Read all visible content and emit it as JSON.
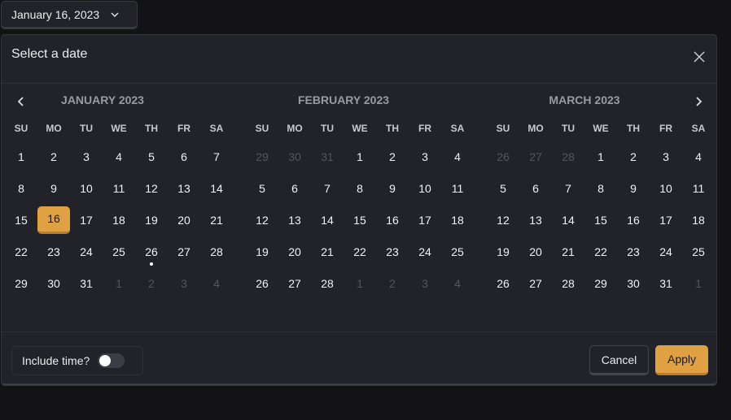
{
  "trigger": {
    "label": "January 16, 2023",
    "icon": "chevron-down-icon"
  },
  "dialog": {
    "title": "Select a date"
  },
  "weekdays": [
    "SU",
    "MO",
    "TU",
    "WE",
    "TH",
    "FR",
    "SA"
  ],
  "months": [
    {
      "title": "JANUARY 2023",
      "days": [
        "1",
        "2",
        "3",
        "4",
        "5",
        "6",
        "7",
        "8",
        "9",
        "10",
        "11",
        "12",
        "13",
        "14",
        "15",
        "16",
        "17",
        "18",
        "19",
        "20",
        "21",
        "22",
        "23",
        "24",
        "25",
        "26",
        "27",
        "28",
        "29",
        "30",
        "31",
        "1",
        "2",
        "3",
        "4"
      ],
      "outside_before": 0,
      "outside_after": 4,
      "selected_index": 15,
      "today_index": 25
    },
    {
      "title": "FEBRUARY 2023",
      "days": [
        "29",
        "30",
        "31",
        "1",
        "2",
        "3",
        "4",
        "5",
        "6",
        "7",
        "8",
        "9",
        "10",
        "11",
        "12",
        "13",
        "14",
        "15",
        "16",
        "17",
        "18",
        "19",
        "20",
        "21",
        "22",
        "23",
        "24",
        "25",
        "26",
        "27",
        "28",
        "1",
        "2",
        "3",
        "4"
      ],
      "outside_before": 3,
      "outside_after": 4,
      "selected_index": -1,
      "today_index": -1
    },
    {
      "title": "MARCH 2023",
      "days": [
        "26",
        "27",
        "28",
        "1",
        "2",
        "3",
        "4",
        "5",
        "6",
        "7",
        "8",
        "9",
        "10",
        "11",
        "12",
        "13",
        "14",
        "15",
        "16",
        "17",
        "18",
        "19",
        "20",
        "21",
        "22",
        "23",
        "24",
        "25",
        "26",
        "27",
        "28",
        "29",
        "30",
        "31",
        "1"
      ],
      "outside_before": 3,
      "outside_after": 1,
      "selected_index": -1,
      "today_index": -1
    }
  ],
  "footer": {
    "include_time_label": "Include time?",
    "include_time": false,
    "cancel": "Cancel",
    "apply": "Apply"
  },
  "colors": {
    "accent": "#e0a142",
    "panel": "#222329",
    "background": "#131316"
  }
}
